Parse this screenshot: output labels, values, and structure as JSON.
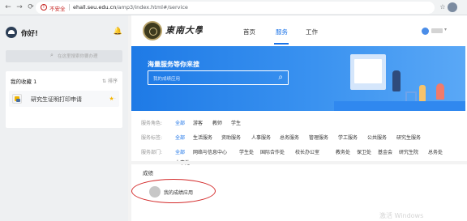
{
  "browser": {
    "security_label": "不安全",
    "url_host": "ehall.seu.edu.cn",
    "url_path": "/amp3/index.html#/service"
  },
  "sidebar": {
    "greeting": "你好!",
    "search_placeholder": "在这里搜索你要办理",
    "favorites": {
      "title": "我的收藏 1",
      "sort_label": "排序",
      "items": [
        {
          "label": "研究生证明打印申请"
        }
      ]
    }
  },
  "header": {
    "logo_text": "東南大學",
    "nav": [
      {
        "label": "首页",
        "active": false
      },
      {
        "label": "服务",
        "active": true
      },
      {
        "label": "工作",
        "active": false
      }
    ]
  },
  "banner": {
    "title": "海量服务等你来搜",
    "search_placeholder": "我的成绩应用"
  },
  "filters": [
    {
      "label": "服务角色:",
      "options": [
        "全部",
        "游客",
        "教师",
        "学生"
      ]
    },
    {
      "label": "服务标签:",
      "options": [
        "全部",
        "生活服务",
        "资助服务",
        "人事服务",
        "总务服务",
        "管理服务",
        "学工服务",
        "公共服务",
        "研究生服务"
      ]
    },
    {
      "label": "服务部门:",
      "options": [
        "全部",
        "网络与信息中心",
        "学生处",
        "国际合作处",
        "校长办公室",
        "教务处",
        "保卫处",
        "基金会",
        "研究生院",
        "总务处",
        "人事处"
      ]
    }
  ],
  "results": {
    "title": "成绩",
    "items": [
      {
        "label": "我的成绩应用"
      }
    ]
  },
  "watermark": "激活 Windows",
  "colors": {
    "accent": "#1a73e8",
    "banner": "#2d86ec",
    "highlight": "#d42b2b",
    "warning": "#c5221f"
  }
}
